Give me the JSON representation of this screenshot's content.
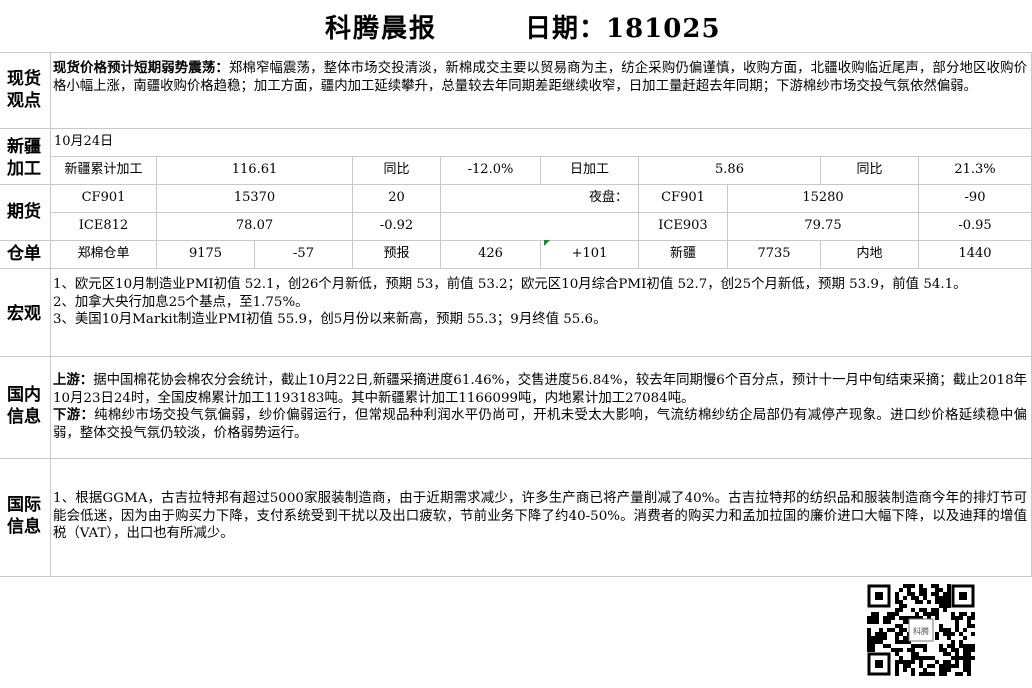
{
  "header": {
    "title": "科腾晨报",
    "date_label": "日期：181025"
  },
  "spot": {
    "label": "现货观点",
    "headline": "现货价格预计短期弱势震荡：",
    "body": "郑棉窄幅震荡，整体市场交投清淡，新棉成交主要以贸易商为主，纺企采购仍偏谨慎，收购方面，北疆收购临近尾声，部分地区收购价格小幅上涨，南疆收购价格趋稳；加工方面，疆内加工延续攀升，总量较去年同期差距继续收窄，日加工量赶超去年同期；下游棉纱市场交投气氛依然偏弱。"
  },
  "xinjiang": {
    "label": "新疆加工",
    "date": "10月24日",
    "cells": [
      "新疆累计加工",
      "116.61",
      "同比",
      "-12.0%",
      "日加工",
      "5.86",
      "同比",
      "21.3%"
    ]
  },
  "futures": {
    "label": "期货",
    "row1": [
      "CF901",
      "15370",
      "20",
      "夜盘：",
      "CF901",
      "15280",
      "-90"
    ],
    "row2": [
      "ICE812",
      "78.07",
      "-0.92",
      "ICE903",
      "79.75",
      "-0.95"
    ]
  },
  "warehouse": {
    "label": "仓单",
    "cells": [
      "郑棉仓单",
      "9175",
      "-57",
      "预报",
      "426",
      "+101",
      "新疆",
      "7735",
      "内地",
      "1440"
    ]
  },
  "macro": {
    "label": "宏观",
    "items": [
      "1、欧元区10月制造业PMI初值 52.1，创26个月新低，预期 53，前值 53.2；欧元区10月综合PMI初值 52.7，创25个月新低，预期 53.9，前值 54.1。",
      "2、加拿大央行加息25个基点，至1.75%。",
      "3、美国10月Markit制造业PMI初值 55.9，创5月份以来新高，预期 55.3；9月终值 55.6。"
    ]
  },
  "domestic": {
    "label": "国内信息",
    "up_label": "上游：",
    "up_text": "据中国棉花协会棉农分会统计，截止10月22日,新疆采摘进度61.46%，交售进度56.84%，较去年同期慢6个百分点，预计十一月中旬结束采摘；截止2018年10月23日24时，全国皮棉累计加工1193183吨。其中新疆累计加工1166099吨，内地累计加工27084吨。",
    "down_label": "下游：",
    "down_text": "纯棉纱市场交投气氛偏弱，纱价偏弱运行，但常规品种利润水平仍尚可，开机未受太大影响，气流纺棉纱纺企局部仍有减停产现象。进口纱价格延续稳中偏弱，整体交投气氛仍较淡，价格弱势运行。"
  },
  "international": {
    "label": "国际信息",
    "text": "1、根据GGMA，古吉拉特邦有超过5000家服装制造商，由于近期需求减少，许多生产商已将产量削减了40%。古吉拉特邦的纺织品和服装制造商今年的排灯节可能会低迷，因为由于购买力下降，支付系统受到干扰以及出口疲软，节前业务下降了约40-50%。消费者的购买力和孟加拉国的廉价进口大幅下降，以及迪拜的增值税（VAT），出口也有所减少。"
  },
  "qr": {
    "center_text": "科腾"
  }
}
